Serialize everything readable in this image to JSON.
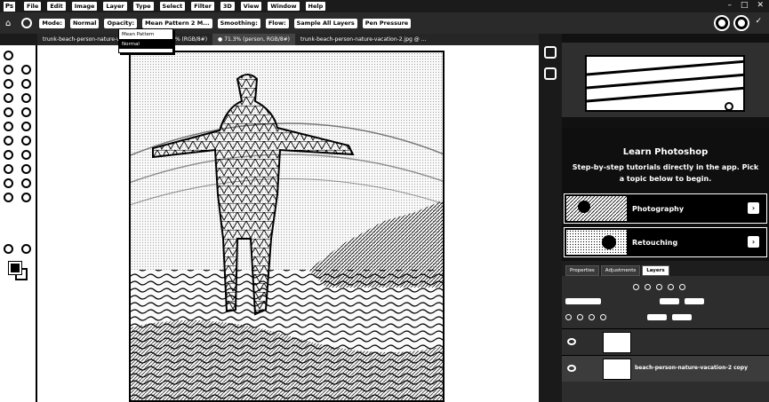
{
  "menubar": {
    "logo": "Ps",
    "items": [
      "File",
      "Edit",
      "Image",
      "Layer",
      "Type",
      "Select",
      "Filter",
      "3D",
      "View",
      "Window",
      "Help"
    ],
    "window_controls": [
      "–",
      "□",
      "✕"
    ]
  },
  "options_bar": {
    "mode_label": "Mode:",
    "mode_value": "Normal",
    "opacity_label": "Opacity:",
    "flow_label": "Flow:",
    "blend_value": "Mean Pattern 2 M...",
    "smoothing_label": "Smoothing:",
    "sample_label": "Sample All Layers",
    "align_label": "Pen Pressure"
  },
  "dropdown": {
    "options": [
      "Mean Pattern",
      "Normal"
    ],
    "selected": "Normal"
  },
  "tabs": [
    {
      "label": "trunk-beach-person-nature-vacation-1.jpg @ 71.3% (RGB/8#)"
    },
    {
      "label": "● 71.3% (person, RGB/8#)"
    },
    {
      "label": "trunk-beach-person-nature-vacation-2.jpg @ ..."
    }
  ],
  "learn": {
    "title": "Learn Photoshop",
    "description": "Step-by-step tutorials directly in the app. Pick a topic below to begin.",
    "topics": [
      {
        "label": "Photography"
      },
      {
        "label": "Retouching"
      }
    ]
  },
  "layers_panel": {
    "tabs": [
      "Properties",
      "Adjustments",
      "Layers"
    ],
    "active_tab": "Layers",
    "layers": [
      {
        "name": ""
      },
      {
        "name": "beach-person-nature-vacation-2 copy"
      }
    ]
  },
  "colors": {
    "dark": "#1b1b1b",
    "panel": "#262626",
    "foreground": "#000000",
    "background": "#ffffff"
  }
}
